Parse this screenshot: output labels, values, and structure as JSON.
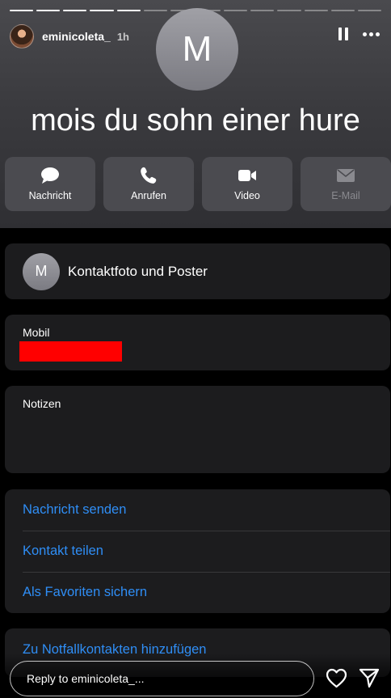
{
  "story": {
    "segments_total": 14,
    "segments_done": 5,
    "username": "eminicoleta_",
    "time": "1h",
    "icons": {
      "avatar": "profile-photo",
      "pause": "pause-icon",
      "more": "more-icon"
    }
  },
  "contact": {
    "initial": "M",
    "name": "mois du sohn einer hure"
  },
  "actions": [
    {
      "label": "Nachricht",
      "icon": "message-bubble-icon",
      "enabled": true
    },
    {
      "label": "Anrufen",
      "icon": "phone-icon",
      "enabled": true
    },
    {
      "label": "Video",
      "icon": "video-camera-icon",
      "enabled": true
    },
    {
      "label": "E-Mail",
      "icon": "envelope-icon",
      "enabled": false
    }
  ],
  "photo_card": {
    "initial": "M",
    "label": "Kontaktfoto und Poster"
  },
  "mobile_card": {
    "label": "Mobil",
    "redaction_color": "#ff0000"
  },
  "notes_card": {
    "label": "Notizen"
  },
  "links": [
    {
      "label": "Nachricht senden"
    },
    {
      "label": "Kontakt teilen"
    },
    {
      "label": "Als Favoriten sichern"
    }
  ],
  "emergency": {
    "label": "Zu Notfallkontakten hinzufügen"
  },
  "reply": {
    "placeholder": "Reply to eminicoleta_..."
  },
  "colors": {
    "link": "#2f8ef6",
    "card_bg": "#1c1c1e",
    "action_bg": "#4b4b50",
    "page_bg": "#000000"
  }
}
